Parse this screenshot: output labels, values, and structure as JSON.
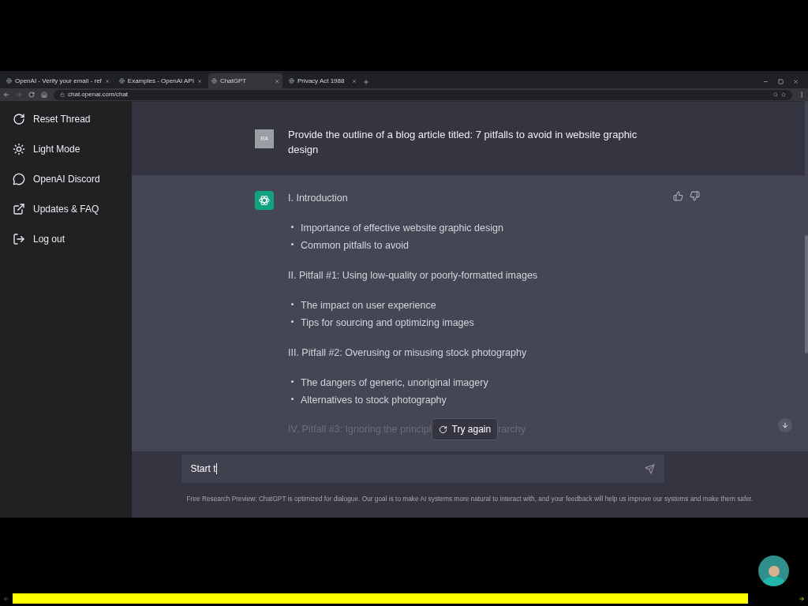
{
  "browser": {
    "tabs": [
      {
        "title": "OpenAI - Verify your email - ref",
        "selected": false
      },
      {
        "title": "Examples - OpenAI API",
        "selected": false
      },
      {
        "title": "ChatGPT",
        "selected": true
      },
      {
        "title": "Privacy Act 1988",
        "selected": false
      }
    ],
    "url": "chat.openai.com/chat"
  },
  "sidebar": {
    "items": [
      {
        "kind": "reset",
        "label": "Reset Thread"
      },
      {
        "kind": "theme",
        "label": "Light Mode"
      },
      {
        "kind": "community",
        "label": "OpenAI Discord"
      },
      {
        "kind": "link",
        "label": "Updates & FAQ"
      },
      {
        "kind": "logout",
        "label": "Log out"
      }
    ]
  },
  "conversation": {
    "user_message": {
      "avatar": "RA",
      "text": "Provide the outline of a blog article titled: 7 pitfalls to avoid in website graphic design"
    },
    "answer": {
      "blocks": [
        {
          "kind": "heading",
          "text": "I. Introduction"
        },
        {
          "kind": "bullets",
          "items": [
            "Importance of effective website graphic design",
            "Common pitfalls to avoid"
          ]
        },
        {
          "kind": "heading",
          "text": "II. Pitfall #1: Using low-quality or poorly-formatted images"
        },
        {
          "kind": "bullets",
          "items": [
            "The impact on user experience",
            "Tips for sourcing and optimizing images"
          ]
        },
        {
          "kind": "heading",
          "text": "III. Pitfall #2: Overusing or misusing stock photography"
        },
        {
          "kind": "bullets",
          "items": [
            "The dangers of generic, unoriginal imagery",
            "Alternatives to stock photography"
          ]
        }
      ],
      "faded_line_start": "IV. Pitfall #3: Ignoring the principl",
      "faded_line_end": "rarchy"
    },
    "try_again": "Try again"
  },
  "composer": {
    "value": "Start t"
  },
  "footer": "Free Research Preview: ChatGPT is optimized for dialogue. Our goal is to make AI systems more natural to interact with, and your feedback will help us improve our systems and make them safer.",
  "video_player": {
    "progress": {
      "level": 0.94
    }
  }
}
